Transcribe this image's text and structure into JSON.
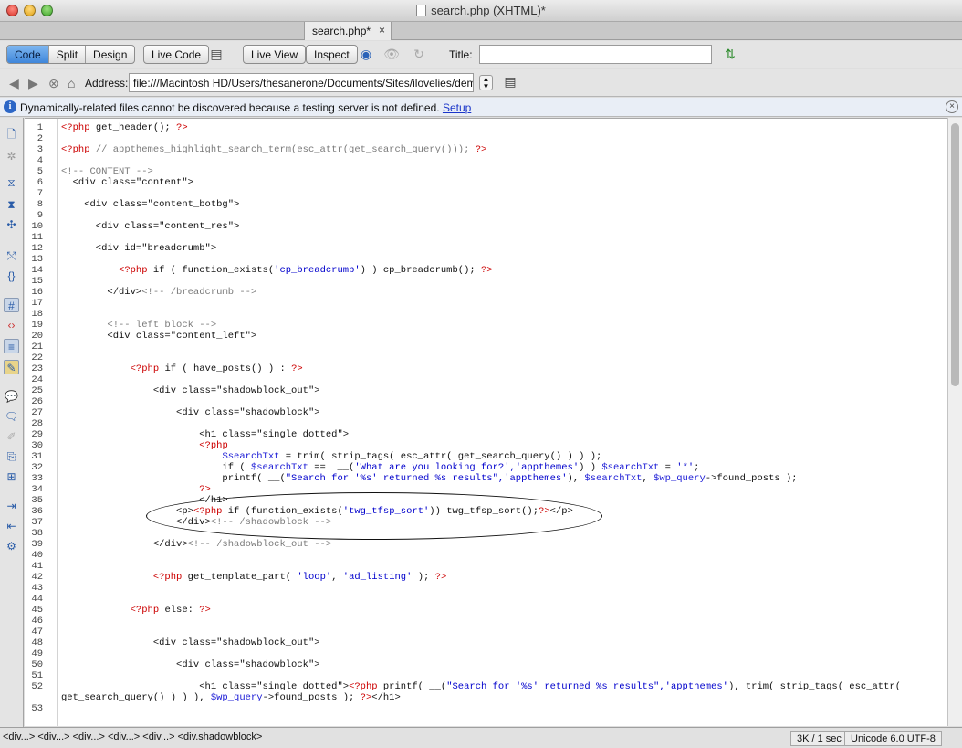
{
  "window": {
    "title": "search.php (XHTML)*"
  },
  "tab": {
    "label": "search.php*",
    "close": "×"
  },
  "toolbar": {
    "view_modes": [
      "Code",
      "Split",
      "Design"
    ],
    "live_code": "Live Code",
    "live_view": "Live View",
    "inspect": "Inspect",
    "title_label": "Title:",
    "title_value": ""
  },
  "address": {
    "label": "Address:",
    "value": "file:///Macintosh HD/Users/thesanerone/Documents/Sites/ilovelies/demo/w"
  },
  "infobar": {
    "text": "Dynamically-related files cannot be discovered because a testing server is not defined.",
    "link": "Setup"
  },
  "code_lines": [
    {
      "n": "1",
      "parts": [
        [
          "php",
          "<?php"
        ],
        [
          "",
          " get_header(); "
        ],
        [
          "php",
          "?>"
        ]
      ]
    },
    {
      "n": "2",
      "parts": []
    },
    {
      "n": "3",
      "parts": [
        [
          "php",
          "<?php"
        ],
        [
          "cmt",
          " // appthemes_highlight_search_term(esc_attr(get_search_query())); "
        ],
        [
          "php",
          "?>"
        ]
      ]
    },
    {
      "n": "4",
      "parts": []
    },
    {
      "n": "5",
      "parts": [
        [
          "cmt",
          "<!-- CONTENT -->"
        ]
      ]
    },
    {
      "n": "6",
      "parts": [
        [
          "",
          "  <div class=\"content\">"
        ]
      ]
    },
    {
      "n": "7",
      "parts": []
    },
    {
      "n": "8",
      "parts": [
        [
          "",
          "    <div class=\"content_botbg\">"
        ]
      ]
    },
    {
      "n": "9",
      "parts": []
    },
    {
      "n": "10",
      "parts": [
        [
          "",
          "      <div class=\"content_res\">"
        ]
      ]
    },
    {
      "n": "11",
      "parts": []
    },
    {
      "n": "12",
      "parts": [
        [
          "",
          "      <div id=\"breadcrumb\">"
        ]
      ]
    },
    {
      "n": "13",
      "parts": []
    },
    {
      "n": "14",
      "parts": [
        [
          "",
          "          "
        ],
        [
          "php",
          "<?php"
        ],
        [
          "",
          " if ( function_exists("
        ],
        [
          "str",
          "'cp_breadcrumb'"
        ],
        [
          "",
          ") ) cp_breadcrumb(); "
        ],
        [
          "php",
          "?>"
        ]
      ]
    },
    {
      "n": "15",
      "parts": []
    },
    {
      "n": "16",
      "parts": [
        [
          "",
          "        </div>"
        ],
        [
          "cmt",
          "<!-- /breadcrumb -->"
        ]
      ]
    },
    {
      "n": "17",
      "parts": []
    },
    {
      "n": "18",
      "parts": []
    },
    {
      "n": "19",
      "parts": [
        [
          "cmt",
          "        <!-- left block -->"
        ]
      ]
    },
    {
      "n": "20",
      "parts": [
        [
          "",
          "        <div class=\"content_left\">"
        ]
      ]
    },
    {
      "n": "21",
      "parts": []
    },
    {
      "n": "22",
      "parts": []
    },
    {
      "n": "23",
      "parts": [
        [
          "",
          "            "
        ],
        [
          "php",
          "<?php"
        ],
        [
          "",
          " if ( have_posts() ) : "
        ],
        [
          "php",
          "?>"
        ]
      ]
    },
    {
      "n": "24",
      "parts": []
    },
    {
      "n": "25",
      "parts": [
        [
          "",
          "                <div class=\"shadowblock_out\">"
        ]
      ]
    },
    {
      "n": "26",
      "parts": []
    },
    {
      "n": "27",
      "parts": [
        [
          "",
          "                    <div class=\"shadowblock\">"
        ]
      ]
    },
    {
      "n": "28",
      "parts": []
    },
    {
      "n": "29",
      "parts": [
        [
          "",
          "                        <h1 class=\"single dotted\">"
        ]
      ]
    },
    {
      "n": "30",
      "parts": [
        [
          "",
          "                        "
        ],
        [
          "php",
          "<?php"
        ]
      ]
    },
    {
      "n": "31",
      "parts": [
        [
          "",
          "                            "
        ],
        [
          "var",
          "$searchTxt"
        ],
        [
          "",
          " = trim( strip_tags( esc_attr( get_search_query() ) ) );"
        ]
      ]
    },
    {
      "n": "32",
      "parts": [
        [
          "",
          "                            if ( "
        ],
        [
          "var",
          "$searchTxt"
        ],
        [
          "",
          " ==  __("
        ],
        [
          "str",
          "'What are you looking for?','appthemes'"
        ],
        [
          "",
          ") ) "
        ],
        [
          "var",
          "$searchTxt"
        ],
        [
          "",
          " = "
        ],
        [
          "str",
          "'*'"
        ],
        [
          "",
          ";"
        ]
      ]
    },
    {
      "n": "33",
      "parts": [
        [
          "",
          "                            printf( __("
        ],
        [
          "str",
          "\"Search for '%s' returned %s results\",'appthemes'"
        ],
        [
          "",
          "), "
        ],
        [
          "var",
          "$searchTxt"
        ],
        [
          "",
          ", "
        ],
        [
          "var",
          "$wp_query"
        ],
        [
          "",
          "->found_posts );"
        ]
      ]
    },
    {
      "n": "34",
      "parts": [
        [
          "",
          "                        "
        ],
        [
          "php",
          "?>"
        ]
      ]
    },
    {
      "n": "35",
      "parts": [
        [
          "",
          "                        </h1>"
        ]
      ]
    },
    {
      "n": "36",
      "parts": [
        [
          "",
          "                    <p>"
        ],
        [
          "php",
          "<?php"
        ],
        [
          "",
          " if (function_exists("
        ],
        [
          "str",
          "'twg_tfsp_sort'"
        ],
        [
          "",
          ")) twg_tfsp_sort();"
        ],
        [
          "php",
          "?>"
        ],
        [
          "",
          "</p>"
        ]
      ]
    },
    {
      "n": "37",
      "parts": [
        [
          "",
          "                    </div>"
        ],
        [
          "cmt",
          "<!-- /shadowblock -->"
        ]
      ]
    },
    {
      "n": "38",
      "parts": []
    },
    {
      "n": "39",
      "parts": [
        [
          "",
          "                </div>"
        ],
        [
          "cmt",
          "<!-- /shadowblock_out -->"
        ]
      ]
    },
    {
      "n": "40",
      "parts": []
    },
    {
      "n": "41",
      "parts": []
    },
    {
      "n": "42",
      "parts": [
        [
          "",
          "                "
        ],
        [
          "php",
          "<?php"
        ],
        [
          "",
          " get_template_part( "
        ],
        [
          "str",
          "'loop'"
        ],
        [
          "",
          ", "
        ],
        [
          "str",
          "'ad_listing'"
        ],
        [
          "",
          " ); "
        ],
        [
          "php",
          "?>"
        ]
      ]
    },
    {
      "n": "43",
      "parts": []
    },
    {
      "n": "44",
      "parts": []
    },
    {
      "n": "45",
      "parts": [
        [
          "",
          "            "
        ],
        [
          "php",
          "<?php"
        ],
        [
          "",
          " else: "
        ],
        [
          "php",
          "?>"
        ]
      ]
    },
    {
      "n": "46",
      "parts": []
    },
    {
      "n": "47",
      "parts": []
    },
    {
      "n": "48",
      "parts": [
        [
          "",
          "                <div class=\"shadowblock_out\">"
        ]
      ]
    },
    {
      "n": "49",
      "parts": []
    },
    {
      "n": "50",
      "parts": [
        [
          "",
          "                    <div class=\"shadowblock\">"
        ]
      ]
    },
    {
      "n": "51",
      "parts": []
    },
    {
      "n": "52",
      "parts": [
        [
          "",
          "                        <h1 class=\"single dotted\">"
        ],
        [
          "php",
          "<?php"
        ],
        [
          "",
          " printf( __("
        ],
        [
          "str",
          "\"Search for '%s' returned %s results\",'appthemes'"
        ],
        [
          "",
          "), trim( strip_tags( esc_attr("
        ]
      ]
    },
    {
      "n": "",
      "parts": [
        [
          "",
          "get_search_query() ) ) ), "
        ],
        [
          "var",
          "$wp_query"
        ],
        [
          "",
          "->found_posts ); "
        ],
        [
          "php",
          "?>"
        ],
        [
          "",
          "</h1>"
        ]
      ]
    },
    {
      "n": "53",
      "parts": []
    }
  ],
  "statusbar": {
    "tag_path": "<div...> <div...> <div...> <div...> <div...> <div.shadowblock>",
    "size_time": "3K / 1 sec",
    "encoding": "Unicode 6.0 UTF-8"
  },
  "colors": {
    "php_delimiter": "#cc0000",
    "string": "#0000cc",
    "comment": "#7a7a7a",
    "variable": "#1b1bd6",
    "active_mode": "#3f86da"
  }
}
